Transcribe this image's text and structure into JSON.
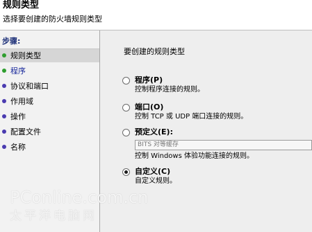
{
  "header": {
    "title": "规则类型",
    "subtitle": "选择要创建的防火墙规则类型"
  },
  "sidebar": {
    "heading": "步骤:",
    "steps": [
      {
        "label": "规则类型",
        "dot_color": "#2f9e2f"
      },
      {
        "label": "程序",
        "dot_color": "#2f9e2f"
      },
      {
        "label": "协议和端口",
        "dot_color": "#4a3bb0"
      },
      {
        "label": "作用域",
        "dot_color": "#4a3bb0"
      },
      {
        "label": "操作",
        "dot_color": "#4a3bb0"
      },
      {
        "label": "配置文件",
        "dot_color": "#4a3bb0"
      },
      {
        "label": "名称",
        "dot_color": "#4a3bb0"
      }
    ]
  },
  "main": {
    "question": "要创建的规则类型",
    "options": [
      {
        "label": "程序(P)",
        "description": "控制程序连接的规则。",
        "checked": false
      },
      {
        "label": "端口(O)",
        "description": "控制 TCP 或 UDP 端口连接的规则。",
        "checked": false
      },
      {
        "label": "预定义(E):",
        "description": "控制 Windows 体验功能连接的规则。",
        "checked": false,
        "select_value": "BITS 对等缓存"
      },
      {
        "label": "自定义(C)",
        "description": "自定义规则。",
        "checked": true
      }
    ]
  },
  "watermark": {
    "text": "PConline.com.cn",
    "text_cn": "太平洋电脑网"
  }
}
